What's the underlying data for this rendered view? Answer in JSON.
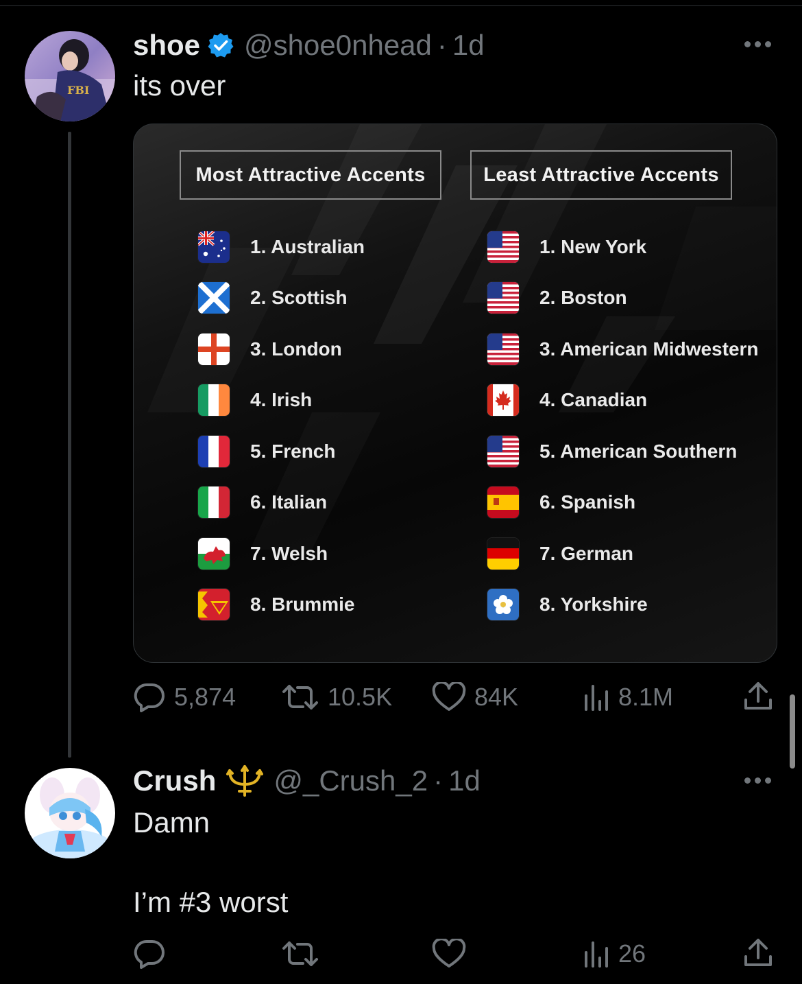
{
  "tweet": {
    "author_name": "shoe",
    "verified_icon": "verified-badge-icon",
    "handle": "@shoe0nhead",
    "separator": "·",
    "time": "1d",
    "text": "its over",
    "media": {
      "left_title": "Most Attractive Accents",
      "right_title": "Least Attractive Accents",
      "most": [
        {
          "label": "1. Australian",
          "flag": "australia-flag-icon"
        },
        {
          "label": "2. Scottish",
          "flag": "scotland-flag-icon"
        },
        {
          "label": "3. London",
          "flag": "england-flag-icon"
        },
        {
          "label": "4. Irish",
          "flag": "ireland-flag-icon"
        },
        {
          "label": "5. French",
          "flag": "france-flag-icon"
        },
        {
          "label": "6. Italian",
          "flag": "italy-flag-icon"
        },
        {
          "label": "7. Welsh",
          "flag": "wales-flag-icon"
        },
        {
          "label": "8. Brummie",
          "flag": "birmingham-flag-icon"
        }
      ],
      "least": [
        {
          "label": "1. New York",
          "flag": "usa-flag-icon"
        },
        {
          "label": "2. Boston",
          "flag": "usa-flag-icon"
        },
        {
          "label": "3. American Midwestern",
          "flag": "usa-flag-icon"
        },
        {
          "label": "4. Canadian",
          "flag": "canada-flag-icon"
        },
        {
          "label": "5. American Southern",
          "flag": "usa-flag-icon"
        },
        {
          "label": "6. Spanish",
          "flag": "spain-flag-icon"
        },
        {
          "label": "7. German",
          "flag": "germany-flag-icon"
        },
        {
          "label": "8. Yorkshire",
          "flag": "yorkshire-flag-icon"
        }
      ]
    },
    "stats": {
      "replies": "5,874",
      "reposts": "10.5K",
      "likes": "84K",
      "views": "8.1M"
    }
  },
  "reply": {
    "author_name": "Crush",
    "name_emoji": "trident-icon",
    "handle": "@_Crush_2",
    "separator": "·",
    "time": "1d",
    "text": "Damn\n\nI’m #3 worst",
    "stats": {
      "views": "26"
    }
  },
  "colors": {
    "background": "#000000",
    "text": "#e7e9ea",
    "secondary": "#71767b",
    "verified": "#1d9bf0"
  }
}
